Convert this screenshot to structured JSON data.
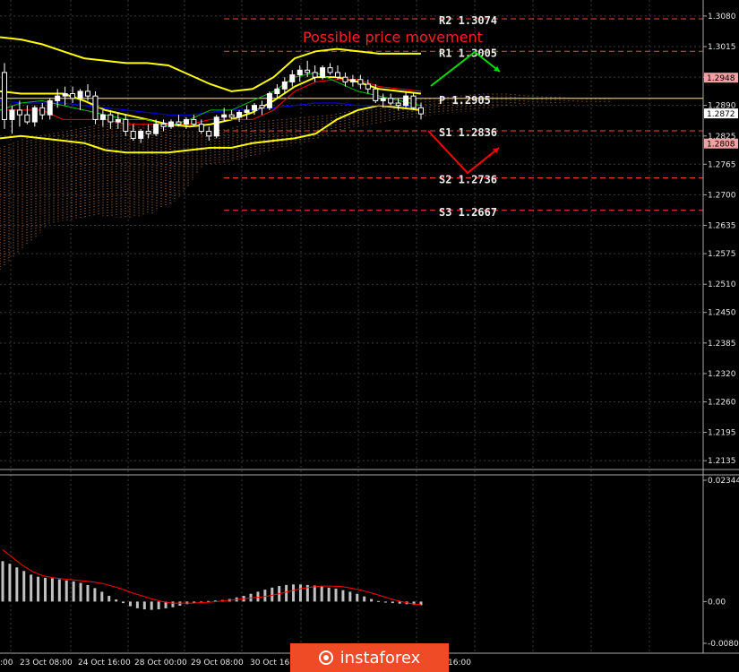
{
  "chart_title": "Possible price movement",
  "colors": {
    "background": "#000000",
    "grid": "#3a3a3a",
    "bollinger": "#ffff00",
    "kijun": "#ff0000",
    "tenkan": "#0000ff",
    "green_line": "#00c000",
    "cloud": "#c77a3c",
    "macd_hist": "#c0c0c0",
    "macd_signal": "#ff0000",
    "up_arrow": "#00dd00",
    "down_arrow": "#ff0000",
    "pivot_line": "#ffff00",
    "level_line": "#ff4040",
    "badge_pink": "#f0a0a0",
    "badge_white": "#ffffff",
    "logo": "#ef4b27"
  },
  "chart_data": [
    {
      "type": "candlestick",
      "title": "Possible price movement",
      "y_axis_ticks": [
        "1.3080",
        "1.3015",
        "1.2950",
        "1.2890",
        "1.2825",
        "1.2765",
        "1.2700",
        "1.2635",
        "1.2575",
        "1.2510",
        "1.2450",
        "1.2385",
        "1.2320",
        "1.2260",
        "1.2195",
        "1.2135"
      ],
      "ylim": [
        1.212,
        1.3095
      ],
      "x_axis_labels": [
        ":00",
        "23 Oct 08:00",
        "24 Oct 16:00",
        "28 Oct 00:00",
        "29 Oct 08:00",
        "30 Oct 16:00",
        "16:00"
      ],
      "levels": [
        {
          "label": "R2",
          "value": "1.3074",
          "kind": "resistance"
        },
        {
          "label": "R1",
          "value": "1.3005",
          "kind": "resistance"
        },
        {
          "label": "P",
          "value": "1.2905",
          "kind": "pivot"
        },
        {
          "label": "S1",
          "value": "1.2836",
          "kind": "support"
        },
        {
          "label": "S2",
          "value": "1.2736",
          "kind": "support"
        },
        {
          "label": "S3",
          "value": "1.2667",
          "kind": "support"
        }
      ],
      "price_badges": [
        {
          "value": "1.2948",
          "style": "pink"
        },
        {
          "value": "1.2872",
          "style": "white"
        },
        {
          "value": "1.2808",
          "style": "pink"
        }
      ],
      "candles": [
        [
          1.296,
          1.298,
          1.284,
          1.286
        ],
        [
          1.286,
          1.289,
          1.283,
          1.288
        ],
        [
          1.288,
          1.29,
          1.2845,
          1.287
        ],
        [
          1.287,
          1.289,
          1.285,
          1.2855
        ],
        [
          1.2855,
          1.289,
          1.2845,
          1.2885
        ],
        [
          1.2885,
          1.2895,
          1.286,
          1.287
        ],
        [
          1.287,
          1.2905,
          1.286,
          1.29
        ],
        [
          1.29,
          1.2925,
          1.2885,
          1.291
        ],
        [
          1.291,
          1.293,
          1.289,
          1.2915
        ],
        [
          1.2915,
          1.293,
          1.2895,
          1.2905
        ],
        [
          1.2905,
          1.2925,
          1.288,
          1.292
        ],
        [
          1.292,
          1.2935,
          1.29,
          1.291
        ],
        [
          1.291,
          1.292,
          1.285,
          1.286
        ],
        [
          1.286,
          1.288,
          1.2845,
          1.287
        ],
        [
          1.287,
          1.288,
          1.284,
          1.2855
        ],
        [
          1.2855,
          1.2875,
          1.284,
          1.286
        ],
        [
          1.286,
          1.287,
          1.2825,
          1.2835
        ],
        [
          1.2835,
          1.285,
          1.2815,
          1.282
        ],
        [
          1.282,
          1.284,
          1.281,
          1.2835
        ],
        [
          1.2835,
          1.285,
          1.282,
          1.283
        ],
        [
          1.283,
          1.286,
          1.2825,
          1.285
        ],
        [
          1.285,
          1.286,
          1.2835,
          1.2845
        ],
        [
          1.2845,
          1.286,
          1.284,
          1.2855
        ],
        [
          1.2855,
          1.287,
          1.2845,
          1.285
        ],
        [
          1.285,
          1.2865,
          1.284,
          1.286
        ],
        [
          1.286,
          1.287,
          1.2845,
          1.285
        ],
        [
          1.285,
          1.286,
          1.283,
          1.2835
        ],
        [
          1.2835,
          1.2845,
          1.2815,
          1.2825
        ],
        [
          1.2825,
          1.287,
          1.282,
          1.2865
        ],
        [
          1.2865,
          1.2885,
          1.2855,
          1.287
        ],
        [
          1.287,
          1.288,
          1.286,
          1.2865
        ],
        [
          1.2865,
          1.288,
          1.2855,
          1.2875
        ],
        [
          1.2875,
          1.289,
          1.286,
          1.288
        ],
        [
          1.288,
          1.2895,
          1.287,
          1.289
        ],
        [
          1.289,
          1.29,
          1.287,
          1.2885
        ],
        [
          1.2885,
          1.292,
          1.288,
          1.2915
        ],
        [
          1.2915,
          1.2935,
          1.2905,
          1.2925
        ],
        [
          1.2925,
          1.295,
          1.2915,
          1.294
        ],
        [
          1.294,
          1.2965,
          1.293,
          1.2955
        ],
        [
          1.2955,
          1.2975,
          1.294,
          1.2965
        ],
        [
          1.2965,
          1.2985,
          1.295,
          1.296
        ],
        [
          1.296,
          1.2975,
          1.294,
          1.295
        ],
        [
          1.295,
          1.2975,
          1.2945,
          1.297
        ],
        [
          1.297,
          1.298,
          1.2955,
          1.296
        ],
        [
          1.296,
          1.2975,
          1.2945,
          1.295
        ],
        [
          1.295,
          1.296,
          1.293,
          1.294
        ],
        [
          1.294,
          1.2955,
          1.293,
          1.2945
        ],
        [
          1.2945,
          1.2955,
          1.2925,
          1.2935
        ],
        [
          1.2935,
          1.2945,
          1.2915,
          1.2925
        ],
        [
          1.2925,
          1.2935,
          1.2895,
          1.29
        ],
        [
          1.29,
          1.2915,
          1.2885,
          1.2905
        ],
        [
          1.2905,
          1.2915,
          1.289,
          1.2895
        ],
        [
          1.2895,
          1.2905,
          1.288,
          1.289
        ],
        [
          1.289,
          1.292,
          1.2885,
          1.291
        ],
        [
          1.291,
          1.2915,
          1.288,
          1.2885
        ],
        [
          1.2885,
          1.2895,
          1.286,
          1.2872
        ]
      ],
      "indicators": {
        "bollinger_upper": [
          1.3035,
          1.303,
          1.302,
          1.3005,
          1.299,
          1.2985,
          1.298,
          1.298,
          1.2975,
          1.2955,
          1.2935,
          1.292,
          1.2925,
          1.295,
          1.299,
          1.3005,
          1.301,
          1.3005,
          1.3,
          1.3,
          1.3
        ],
        "bollinger_middle": [
          1.292,
          1.2915,
          1.2915,
          1.2915,
          1.29,
          1.288,
          1.287,
          1.286,
          1.285,
          1.2845,
          1.285,
          1.286,
          1.2875,
          1.29,
          1.293,
          1.295,
          1.295,
          1.294,
          1.2925,
          1.292,
          1.2915
        ],
        "bollinger_lower": [
          1.282,
          1.2825,
          1.282,
          1.2815,
          1.281,
          1.2795,
          1.279,
          1.279,
          1.279,
          1.2795,
          1.28,
          1.28,
          1.281,
          1.2815,
          1.282,
          1.283,
          1.286,
          1.288,
          1.289,
          1.2885,
          1.288
        ],
        "tenkan": [
          1.29,
          1.2895,
          1.2895,
          1.2895,
          1.289,
          1.2885,
          1.288,
          1.2875,
          1.287,
          1.287,
          1.2875,
          1.288,
          1.288,
          1.2885,
          1.289,
          1.2895,
          1.2895,
          1.289,
          1.289,
          1.289,
          1.2885
        ],
        "kijun": [
          1.288,
          1.288,
          1.288,
          1.286,
          1.286,
          1.286,
          1.285,
          1.285,
          1.285,
          1.285,
          1.286,
          1.286,
          1.286,
          1.288,
          1.292,
          1.294,
          1.2945,
          1.2945,
          1.293,
          1.2925,
          1.292
        ],
        "green": [
          1.288,
          1.2895,
          1.29,
          1.289,
          1.288,
          1.287,
          1.286,
          1.286,
          1.2845,
          1.286,
          1.288,
          1.288,
          1.29,
          1.292,
          1.295,
          1.296,
          1.294,
          1.292,
          1.291,
          1.29,
          1.289
        ],
        "cloud_upper": [
          1.28,
          1.282,
          1.283,
          1.284,
          1.285,
          1.2855,
          1.2845,
          1.2835,
          1.2835,
          1.284,
          1.2855,
          1.286,
          1.2865,
          1.287,
          1.288,
          1.289,
          1.29,
          1.2905,
          1.291,
          1.2915,
          1.2915,
          1.291,
          1.2908,
          1.2905,
          1.2905
        ],
        "cloud_lower": [
          1.254,
          1.259,
          1.264,
          1.265,
          1.2655,
          1.265,
          1.266,
          1.269,
          1.276,
          1.277,
          1.278,
          1.28,
          1.281,
          1.283,
          1.2845,
          1.285,
          1.286,
          1.287,
          1.2875,
          1.288,
          1.289,
          1.2895,
          1.2895,
          1.2895,
          1.2895
        ]
      }
    },
    {
      "type": "bar",
      "title": "",
      "y_axis_ticks": [
        "0.02344",
        "0.00",
        "-0.00807"
      ],
      "ylim": [
        -0.00807,
        0.02344
      ],
      "histogram": [
        0.0078,
        0.0073,
        0.0066,
        0.0059,
        0.0052,
        0.0048,
        0.0046,
        0.0045,
        0.0043,
        0.0041,
        0.0039,
        0.0036,
        0.0032,
        0.0026,
        0.0019,
        0.0011,
        0.0004,
        -0.0003,
        -0.0009,
        -0.0013,
        -0.0015,
        -0.0016,
        -0.0015,
        -0.0013,
        -0.0011,
        -0.0008,
        -0.0005,
        -0.0003,
        -0.0001,
        0.0001,
        0.0002,
        0.0003,
        0.0005,
        0.0008,
        0.0011,
        0.0015,
        0.0019,
        0.0023,
        0.0027,
        0.003,
        0.0032,
        0.0033,
        0.0033,
        0.0032,
        0.0031,
        0.0029,
        0.0027,
        0.0025,
        0.0022,
        0.0019,
        0.0015,
        0.001,
        0.0005,
        0.0001,
        -0.0002,
        -0.0003,
        -0.0004,
        -0.0005,
        -0.0006,
        -0.0007
      ],
      "signal": [
        0.01,
        0.0085,
        0.007,
        0.0058,
        0.005,
        0.0046,
        0.0044,
        0.0042,
        0.004,
        0.0038,
        0.0035,
        0.003,
        0.0024,
        0.0017,
        0.0011,
        0.0005,
        0.0,
        -0.0003,
        -0.0003,
        -0.0003,
        -0.0002,
        -0.0001,
        0.0001,
        0.0003,
        0.0005,
        0.0007,
        0.0009,
        0.0012,
        0.0016,
        0.0021,
        0.0025,
        0.0028,
        0.003,
        0.003,
        0.0029,
        0.0026,
        0.0022,
        0.0017,
        0.0011,
        0.0005,
        0.0,
        -0.0004,
        -0.0006
      ]
    }
  ],
  "logo": {
    "text": "instaforex"
  }
}
